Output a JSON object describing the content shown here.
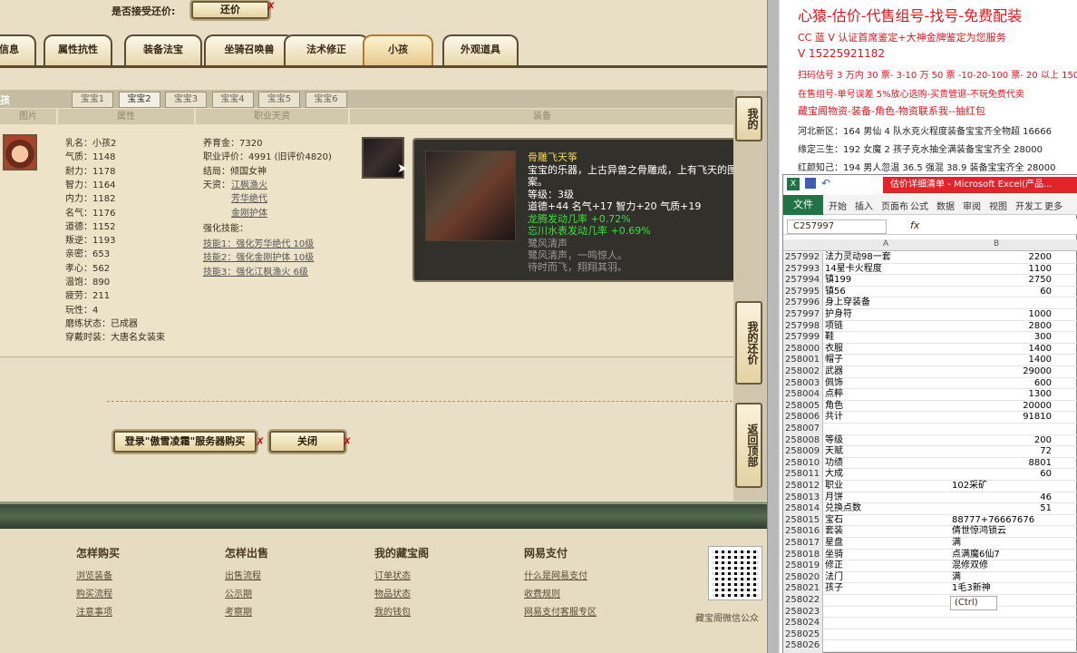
{
  "game": {
    "accept_label": "是否接受还价:",
    "counter_button": "还价",
    "tabs": [
      "信息",
      "属性抗性",
      "装备法宝",
      "坐骑召唤兽",
      "法术修正",
      "小孩",
      "外观道具"
    ],
    "active_tab": "小孩",
    "left_label": "孩",
    "subtabs": [
      "宝宝1",
      "宝宝2",
      "宝宝3",
      "宝宝4",
      "宝宝5",
      "宝宝6"
    ],
    "active_subtab": "宝宝2",
    "columns": [
      "图片",
      "属性",
      "职业天资",
      "装备"
    ],
    "stats_left": [
      "乳名：小孩2",
      "气质：1148",
      "耐力：1178",
      "智力：1164",
      "内力：1182",
      "名气：1176",
      "道德：1152",
      "叛逆：1193",
      "亲密：653",
      "孝心：562",
      "温饱：890",
      "疲劳：211",
      "玩性：4",
      "磨练状态：已成器",
      "穿戴时装：大唐名女装束"
    ],
    "stats_mid": [
      "养育金：7320",
      "职业评价：4991 (旧评价4820)",
      "结局：倾国女神",
      "天资："
    ],
    "talents": [
      "江枫渔火",
      "芳华绝代",
      "金刚护体"
    ],
    "skill_title": "强化技能：",
    "skills": [
      "技能1：强化芳华绝代 10级",
      "技能2：强化金刚护体 10级",
      "技能3：强化江枫渔火 6级"
    ],
    "tooltip": {
      "name": "骨雕飞天筝",
      "desc1": "宝宝的乐器，上古异兽之骨雕成，上有飞天的图",
      "desc2": "案。",
      "level": "等级：3级",
      "attrs": "道德+44 名气+17 智力+20 气质+19",
      "effect1": "龙腾发动几率 +0.72%",
      "effect2": "忘川水表发动几率 +0.69%",
      "flavor1": "鹭风清声",
      "flavor2": "鹭风清声，一鸣惊人。",
      "flavor3": "待时而飞，翔翔其羽。"
    },
    "login_button": "登录\"傲雪凌霜\"服务器购买",
    "close_button": "关闭",
    "side_buttons": [
      "我的",
      "我的还价",
      "返回顶部"
    ],
    "footer": {
      "heads": [
        "怎样购买",
        "怎样出售",
        "我的藏宝阁",
        "网易支付"
      ],
      "col1": [
        "浏览装备",
        "购买流程",
        "注意事项"
      ],
      "col2": [
        "出售流程",
        "公示期",
        "考察期"
      ],
      "col3": [
        "订单状态",
        "物品状态",
        "我的钱包"
      ],
      "col4": [
        "什么是网易支付",
        "收费规则",
        "网易支付客服专区"
      ],
      "qr_caption": "藏宝阁微信公众"
    }
  },
  "ad": {
    "line1": "心猿-估价-代售组号-找号-免费配装",
    "line2": "CC 蓝 V 认证首席鉴定+大神金牌鉴定为您服务",
    "line3": "V 15225921182",
    "line4": "扫码估号 3 万内 30 票- 3-10 万 50 票 -10-20-100 票- 20 以上 150",
    "line5": "在售组号-单号误差 5%放心选购-买贵管退-不玩免费代卖",
    "line6": "藏宝阁物资-装备-角色-物资联系我--抽红包",
    "line7": "河北新区：164 男仙 4 队水克火程度装备宝宝齐全物超 16666",
    "line8": "缘定三生：192 女魔 2 孩子克水抽全满装备宝宝齐全 28000",
    "line9": "红颜知己：194 男人忽温 36.5 强混 38.9 装备宝宝齐全 28000"
  },
  "excel": {
    "title_text": "估价详细清单 - Microsoft Excel(产品...",
    "file_tab": "文件",
    "menus": [
      "开始",
      "插入",
      "页面布",
      "公式",
      "数据",
      "审阅",
      "视图",
      "开发工",
      "更多"
    ],
    "name_box": "C257997",
    "fx": "fx",
    "col_a": "A",
    "col_b": "B",
    "ctrl_label": "(Ctrl)",
    "rows": [
      {
        "n": "257992",
        "a": "法力灵动98一套",
        "b": "2200"
      },
      {
        "n": "257993",
        "a": "14星卡火程度",
        "b": "1100"
      },
      {
        "n": "257994",
        "a": "镇199",
        "b": "2750"
      },
      {
        "n": "257995",
        "a": "镇56",
        "b": "60"
      },
      {
        "n": "257996",
        "a": "身上穿装备",
        "b": ""
      },
      {
        "n": "257997",
        "a": "护身符",
        "b": "1000"
      },
      {
        "n": "257998",
        "a": "项链",
        "b": "2800"
      },
      {
        "n": "257999",
        "a": "鞋",
        "b": "300"
      },
      {
        "n": "258000",
        "a": "衣服",
        "b": "1400"
      },
      {
        "n": "258001",
        "a": "帽子",
        "b": "1400"
      },
      {
        "n": "258002",
        "a": "武器",
        "b": "29000"
      },
      {
        "n": "258003",
        "a": "佩饰",
        "b": "600"
      },
      {
        "n": "258004",
        "a": "点粹",
        "b": "1300"
      },
      {
        "n": "258005",
        "a": "角色",
        "b": "20000"
      },
      {
        "n": "258006",
        "a": "共计",
        "b": "91810"
      },
      {
        "n": "258007",
        "a": "",
        "b": ""
      },
      {
        "n": "258008",
        "a": "等级",
        "b": "200"
      },
      {
        "n": "258009",
        "a": "天赋",
        "b": "72"
      },
      {
        "n": "258010",
        "a": "功绩",
        "b": "8801"
      },
      {
        "n": "258011",
        "a": "大成",
        "b": "60"
      },
      {
        "n": "258012",
        "a": "职业",
        "b": "102采矿",
        "l": true
      },
      {
        "n": "258013",
        "a": "月饼",
        "b": "46"
      },
      {
        "n": "258014",
        "a": "兑换点数",
        "b": "51"
      },
      {
        "n": "258015",
        "a": "宝石",
        "b": "88777+76667676",
        "l": true
      },
      {
        "n": "258016",
        "a": "套装",
        "b": "倩世惊鸿锁云",
        "l": true
      },
      {
        "n": "258017",
        "a": "星盘",
        "b": "满",
        "l": true
      },
      {
        "n": "258018",
        "a": "坐骑",
        "b": "点满魔6仙7",
        "l": true
      },
      {
        "n": "258019",
        "a": "修正",
        "b": "混修双修",
        "l": true
      },
      {
        "n": "258020",
        "a": "法门",
        "b": "满",
        "l": true
      },
      {
        "n": "258021",
        "a": "孩子",
        "b": "1毛3新神",
        "l": true
      },
      {
        "n": "258022",
        "a": "",
        "b": ""
      },
      {
        "n": "258023",
        "a": "",
        "b": ""
      },
      {
        "n": "258024",
        "a": "",
        "b": ""
      },
      {
        "n": "258025",
        "a": "",
        "b": ""
      },
      {
        "n": "258026",
        "a": "",
        "b": ""
      },
      {
        "n": "258027",
        "a": "",
        "b": ""
      }
    ]
  },
  "colors": {
    "ad_red": "#e0141e",
    "tt_title": "#f0d060",
    "tt_green": "#3ce03c",
    "excel_green": "#217346"
  }
}
